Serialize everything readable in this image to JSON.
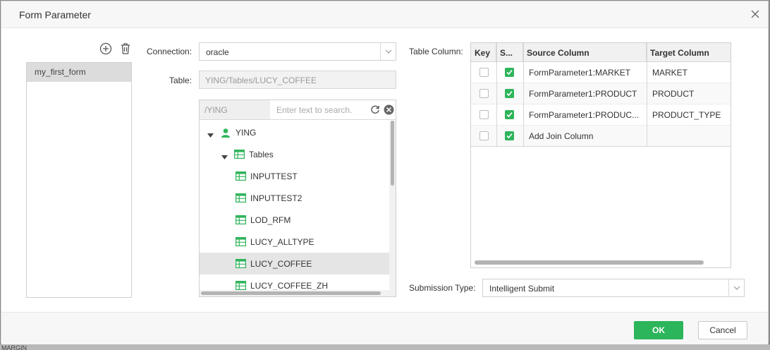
{
  "dialog": {
    "title": "Form Parameter",
    "close_icon": "close-icon"
  },
  "background": {
    "partial_text": "MARGIN"
  },
  "form_list": {
    "items": [
      {
        "label": "my_first_form",
        "selected": true
      }
    ],
    "add_icon": "plus-circle-icon",
    "delete_icon": "trash-icon"
  },
  "connection": {
    "label": "Connection:",
    "value": "oracle"
  },
  "table": {
    "label": "Table:",
    "value": "YING/Tables/LUCY_COFFEE"
  },
  "tree": {
    "path": "/YING",
    "search_placeholder": "Enter text to search.",
    "nodes": [
      {
        "label": "YING",
        "icon": "user-icon",
        "level": 0,
        "expanded": true
      },
      {
        "label": "Tables",
        "icon": "table-icon",
        "level": 1,
        "expanded": true
      },
      {
        "label": "INPUTTEST",
        "icon": "table-icon",
        "level": 2
      },
      {
        "label": "INPUTTEST2",
        "icon": "table-icon",
        "level": 2
      },
      {
        "label": "LOD_RFM",
        "icon": "table-icon",
        "level": 2
      },
      {
        "label": "LUCY_ALLTYPE",
        "icon": "table-icon",
        "level": 2
      },
      {
        "label": "LUCY_COFFEE",
        "icon": "table-icon",
        "level": 2,
        "selected": true
      },
      {
        "label": "LUCY_COFFEE_ZH",
        "icon": "table-icon",
        "level": 2
      }
    ]
  },
  "table_column": {
    "label": "Table Column:",
    "headers": {
      "key": "Key",
      "select": "S...",
      "source": "Source Column",
      "target": "Target Column"
    },
    "rows": [
      {
        "key": false,
        "selected": true,
        "source": "FormParameter1:MARKET",
        "target": "MARKET"
      },
      {
        "key": false,
        "selected": true,
        "source": "FormParameter1:PRODUCT",
        "target": "PRODUCT"
      },
      {
        "key": false,
        "selected": true,
        "source": "FormParameter1:PRODUC...",
        "target": "PRODUCT_TYPE"
      },
      {
        "key": false,
        "selected": true,
        "source": "Add Join Column",
        "target": ""
      }
    ]
  },
  "submission": {
    "label": "Submission Type:",
    "value": "Intelligent Submit"
  },
  "footer": {
    "ok_label": "OK",
    "cancel_label": "Cancel"
  },
  "colors": {
    "accent": "#2cb55a",
    "checkbox": "#2fb45a",
    "selected_row": "#e5e5e5"
  }
}
